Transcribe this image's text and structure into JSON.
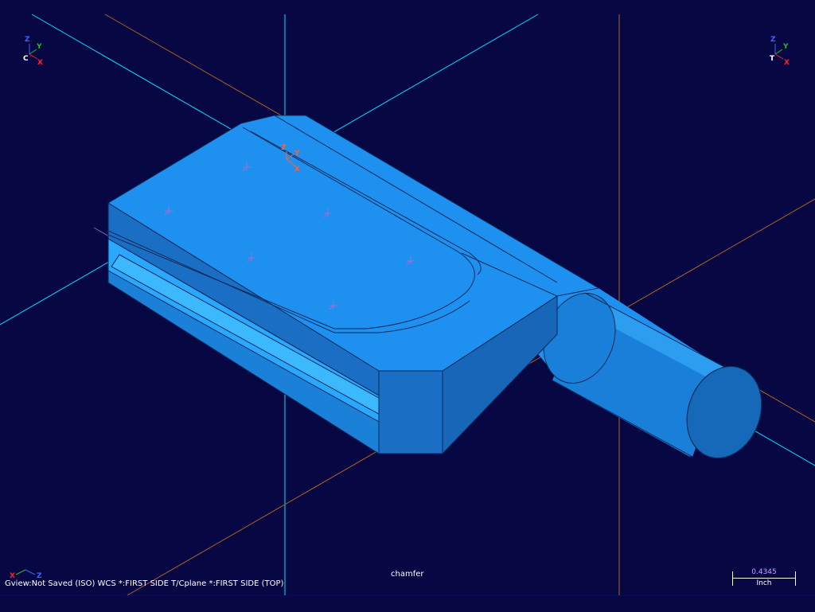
{
  "gnomons": {
    "top_left": {
      "z": "Z",
      "y": "Y",
      "x": "X",
      "c": "C"
    },
    "top_right": {
      "z": "Z",
      "y": "Y",
      "x": "X",
      "t": "T"
    },
    "model": {
      "z": "Z",
      "y": "Y",
      "x": "X"
    },
    "bottom_left": {
      "x": "X",
      "z": "Z"
    }
  },
  "status": {
    "view_text": "Gview:Not Saved (ISO)   WCS *:FIRST SIDE   T/Cplane *:FIRST SIDE (TOP)"
  },
  "label": {
    "text": "chamfer"
  },
  "scale": {
    "value": "0.4345",
    "unit": "Inch"
  },
  "colors": {
    "background": "#070744",
    "part_top": "#1e90ef",
    "part_side": "#1a6fc4",
    "part_face": "#2a9fff",
    "edge": "#0a2a5a",
    "axis_cyan": "#00e0ff",
    "axis_orange": "#b06020",
    "point_marker": "#a070d0"
  }
}
